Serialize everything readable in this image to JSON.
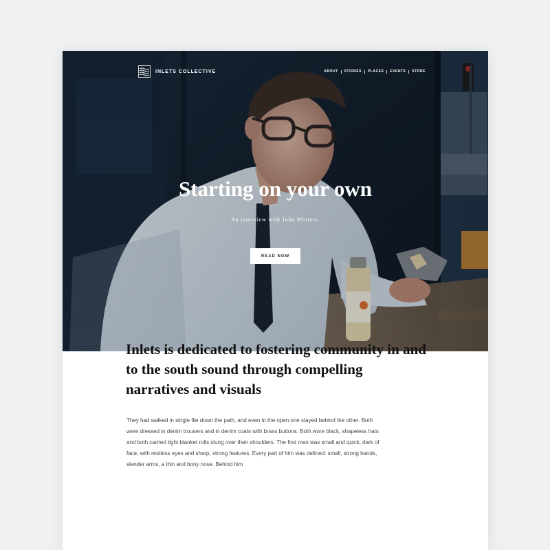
{
  "brand": {
    "name": "INLETS COLLECTIVE",
    "logo_icon": "waves-icon"
  },
  "nav": {
    "items": [
      "ABOUT",
      "STORIES",
      "PLACES",
      "EVENTS",
      "STORE"
    ]
  },
  "hero": {
    "title": "Starting on your own",
    "subtitle": "An interview with John Winters.",
    "cta_label": "READ NOW",
    "photo_description_colors": {
      "shirt": "#d7dee4",
      "background_dark": "#13202d",
      "accent_orange": "#c9852c"
    }
  },
  "intro": {
    "heading": "Inlets is dedicated to fostering community in and to the south sound through compelling narratives and visuals",
    "body": "They had walked in single file down the path, and even in the open one stayed behind the other. Both were dressed in denim trousers and in denim coats with brass buttons. Both wore black, shapeless hats and both carried tight blanket rolls slung over their shoulders. The first man was small and quick, dark of face, with restless eyes and sharp, strong features. Every part of him was defined: small, strong hands, slender arms, a thin and bony nose. Behind him"
  }
}
